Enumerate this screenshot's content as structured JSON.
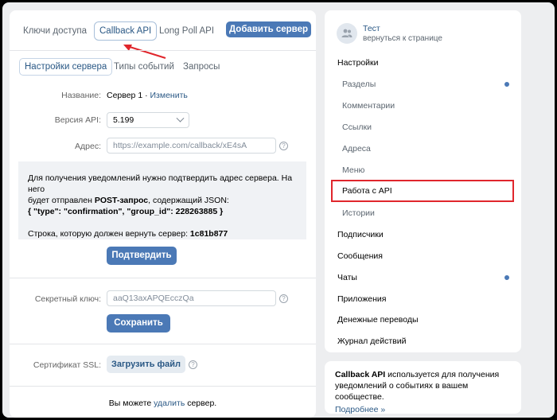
{
  "top_tabs": {
    "access_keys": "Ключи доступа",
    "callback_api": "Callback API",
    "long_poll_api": "Long Poll API",
    "add_server": "Добавить сервер"
  },
  "sub_tabs": {
    "server_settings": "Настройки сервера",
    "event_types": "Типы событий",
    "requests": "Запросы"
  },
  "form": {
    "name_label": "Название:",
    "name_value": "Сервер 1 ·",
    "name_change": "Изменить",
    "api_label": "Версия API:",
    "api_value": "5.199",
    "address_label": "Адрес:",
    "address_placeholder": "https://example.com/callback/xE4sA",
    "help_glyph": "?"
  },
  "notice": {
    "line1": "Для получения уведомлений нужно подтвердить адрес сервера. На него",
    "line2_pre": "будет отправлен ",
    "line2_bold": "POST-запрос",
    "line2_post": ", содержащий JSON:",
    "line3": "{ \"type\": \"confirmation\", \"group_id\": 228263885 }",
    "line4_pre": "Строка, которую должен вернуть сервер: ",
    "line4_bold": "1c81b877"
  },
  "confirm_button": "Подтвердить",
  "secret": {
    "label": "Секретный ключ:",
    "value": "aaQ13axAPQEcczQa",
    "save_button": "Сохранить"
  },
  "ssl": {
    "label": "Сертификат SSL:",
    "upload_button": "Загрузить файл"
  },
  "footer": {
    "pre": "Вы можете ",
    "link": "удалить",
    "post": " сервер."
  },
  "sidebar": {
    "profile_name": "Тест",
    "profile_back": "вернуться к странице",
    "items": [
      {
        "label": "Настройки"
      },
      {
        "label": "Разделы"
      },
      {
        "label": "Комментарии"
      },
      {
        "label": "Ссылки"
      },
      {
        "label": "Адреса"
      },
      {
        "label": "Меню"
      },
      {
        "label": "Работа с API"
      },
      {
        "label": "Истории"
      },
      {
        "label": "Подписчики"
      },
      {
        "label": "Сообщения"
      },
      {
        "label": "Чаты"
      },
      {
        "label": "Приложения"
      },
      {
        "label": "Денежные переводы"
      },
      {
        "label": "Журнал действий"
      }
    ]
  },
  "promo": {
    "bold": "Callback API",
    "text": " используется для получения уведомлений о событиях в вашем сообществе.",
    "more": "Подробнее »"
  },
  "colors": {
    "accent": "#4b79b6",
    "link": "#2a5885",
    "highlight": "#e0262c"
  }
}
